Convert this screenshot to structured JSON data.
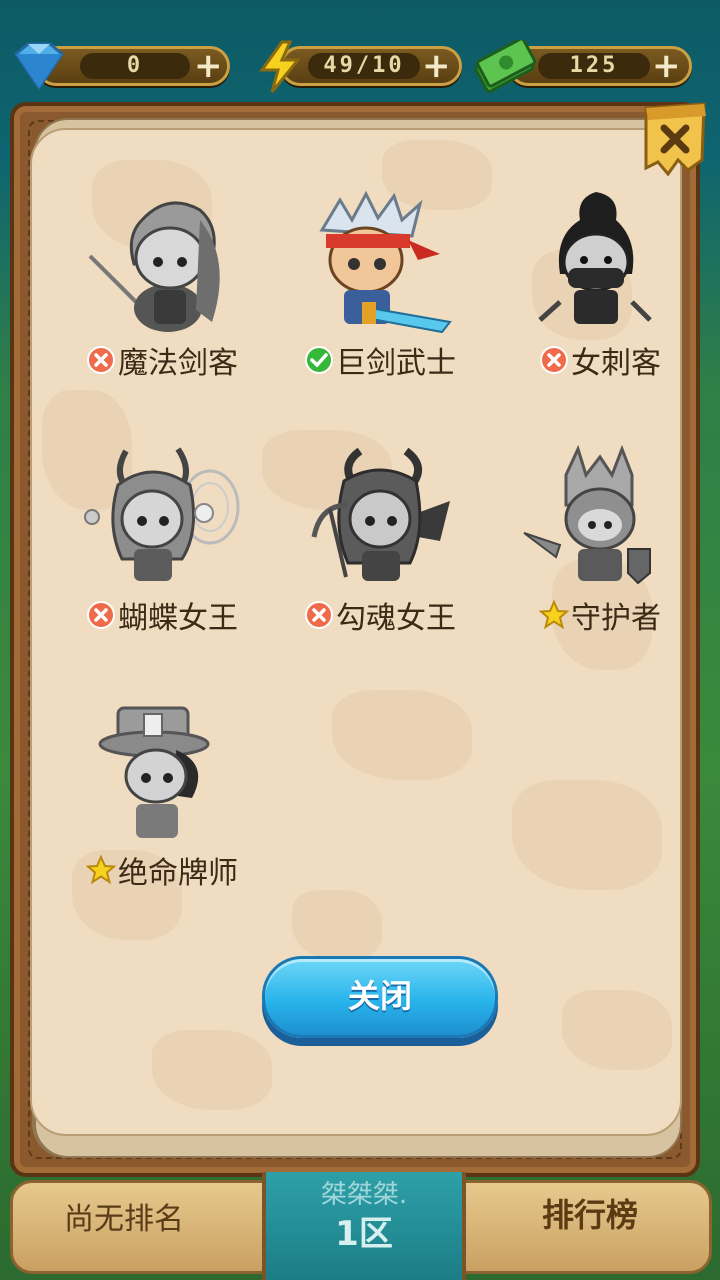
{
  "resources": [
    {
      "icon": "gem-icon",
      "value": "0",
      "action": "+"
    },
    {
      "icon": "lightning-icon",
      "value": "49/10",
      "action": "+"
    },
    {
      "icon": "cash-icon",
      "value": "125",
      "action": "+"
    }
  ],
  "colors": {
    "paper": "#f0dcc0",
    "frame": "#8a5a2e",
    "button": "#29b4ec",
    "locked": "#ef6b4a",
    "unlocked": "#35b83a",
    "star": "#f6d21e"
  },
  "characters": [
    {
      "name": "魔法剑客",
      "status": "locked",
      "status_icon": "x-circle-icon",
      "icon": "swordsman-portrait-icon"
    },
    {
      "name": "巨剑武士",
      "status": "owned",
      "status_icon": "check-circle-icon",
      "icon": "greatsword-warrior-portrait-icon"
    },
    {
      "name": "女刺客",
      "status": "locked",
      "status_icon": "x-circle-icon",
      "icon": "assassin-portrait-icon"
    },
    {
      "name": "蝴蝶女王",
      "status": "locked",
      "status_icon": "x-circle-icon",
      "icon": "butterfly-queen-portrait-icon"
    },
    {
      "name": "勾魂女王",
      "status": "locked",
      "status_icon": "x-circle-icon",
      "icon": "soul-queen-portrait-icon"
    },
    {
      "name": "守护者",
      "status": "special",
      "status_icon": "star-icon",
      "icon": "guardian-portrait-icon"
    },
    {
      "name": "绝命牌师",
      "status": "special",
      "status_icon": "star-icon",
      "icon": "card-master-portrait-icon"
    }
  ],
  "close_button": "关闭",
  "bottom_bar": {
    "rank_text": "尚无排名",
    "server_name": "桀桀桀.",
    "server_zone": "1区",
    "leaderboard": "排行榜"
  }
}
